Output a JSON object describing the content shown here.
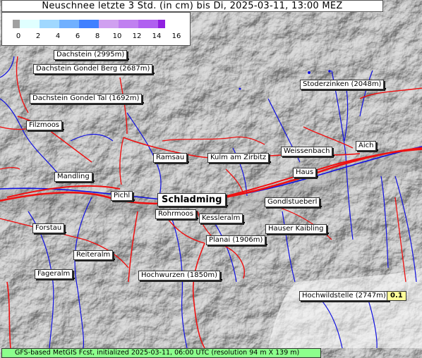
{
  "title": "Neuschnee letzte 3 Std. (in cm) bis Di, 2025-03-11, 13:00 MEZ",
  "legend": {
    "ticks": [
      "0",
      "2",
      "4",
      "6",
      "8",
      "10",
      "12",
      "14",
      "16"
    ],
    "colors": [
      "#a0a0a0",
      "#e0ffff",
      "#a0d8ff",
      "#70b0ff",
      "#4080ff",
      "#1060ff",
      "#d0a0f0",
      "#c080f0",
      "#b060f0",
      "#9020e0"
    ]
  },
  "places": [
    {
      "id": "dachstein",
      "name": "Dachstein (2995m)"
    },
    {
      "id": "dachstein-gondel-berg",
      "name": "Dachstein Gondel Berg (2687m)"
    },
    {
      "id": "dachstein-gondel-tal",
      "name": "Dachstein Gondel Tal (1692m)"
    },
    {
      "id": "filzmoos",
      "name": "Filzmoos"
    },
    {
      "id": "stoderzinken",
      "name": "Stoderzinken (2048m)"
    },
    {
      "id": "aich",
      "name": "Aich"
    },
    {
      "id": "weissenbach",
      "name": "Weissenbach"
    },
    {
      "id": "ramsau",
      "name": "Ramsau"
    },
    {
      "id": "kulm-am-zirbitz",
      "name": "Kulm am Zirbitz"
    },
    {
      "id": "haus",
      "name": "Haus"
    },
    {
      "id": "mandling",
      "name": "Mandling"
    },
    {
      "id": "pichl",
      "name": "Pichl"
    },
    {
      "id": "schladming",
      "name": "Schladming"
    },
    {
      "id": "gondlstueberl",
      "name": "Gondlstueberl"
    },
    {
      "id": "rohrmoos",
      "name": "Rohrmoos"
    },
    {
      "id": "kesslerlalm",
      "name": "Kessleralm"
    },
    {
      "id": "forstau",
      "name": "Forstau"
    },
    {
      "id": "hauser-kaibling",
      "name": "Hauser Kaibling"
    },
    {
      "id": "planai",
      "name": "Planai (1906m)"
    },
    {
      "id": "reiteralm",
      "name": "Reiteralm"
    },
    {
      "id": "fageralm",
      "name": "Fageralm"
    },
    {
      "id": "hochwurzen",
      "name": "Hochwurzen (1850m)"
    },
    {
      "id": "hochwildstelle",
      "name": "Hochwildstelle (2747m)"
    }
  ],
  "hochwildstelle_value": "0.1",
  "footer": "GFS-based MetGIS Fcst, initialized 2025-03-11, 06:00 UTC  (resolution 94 m X 139 m)"
}
